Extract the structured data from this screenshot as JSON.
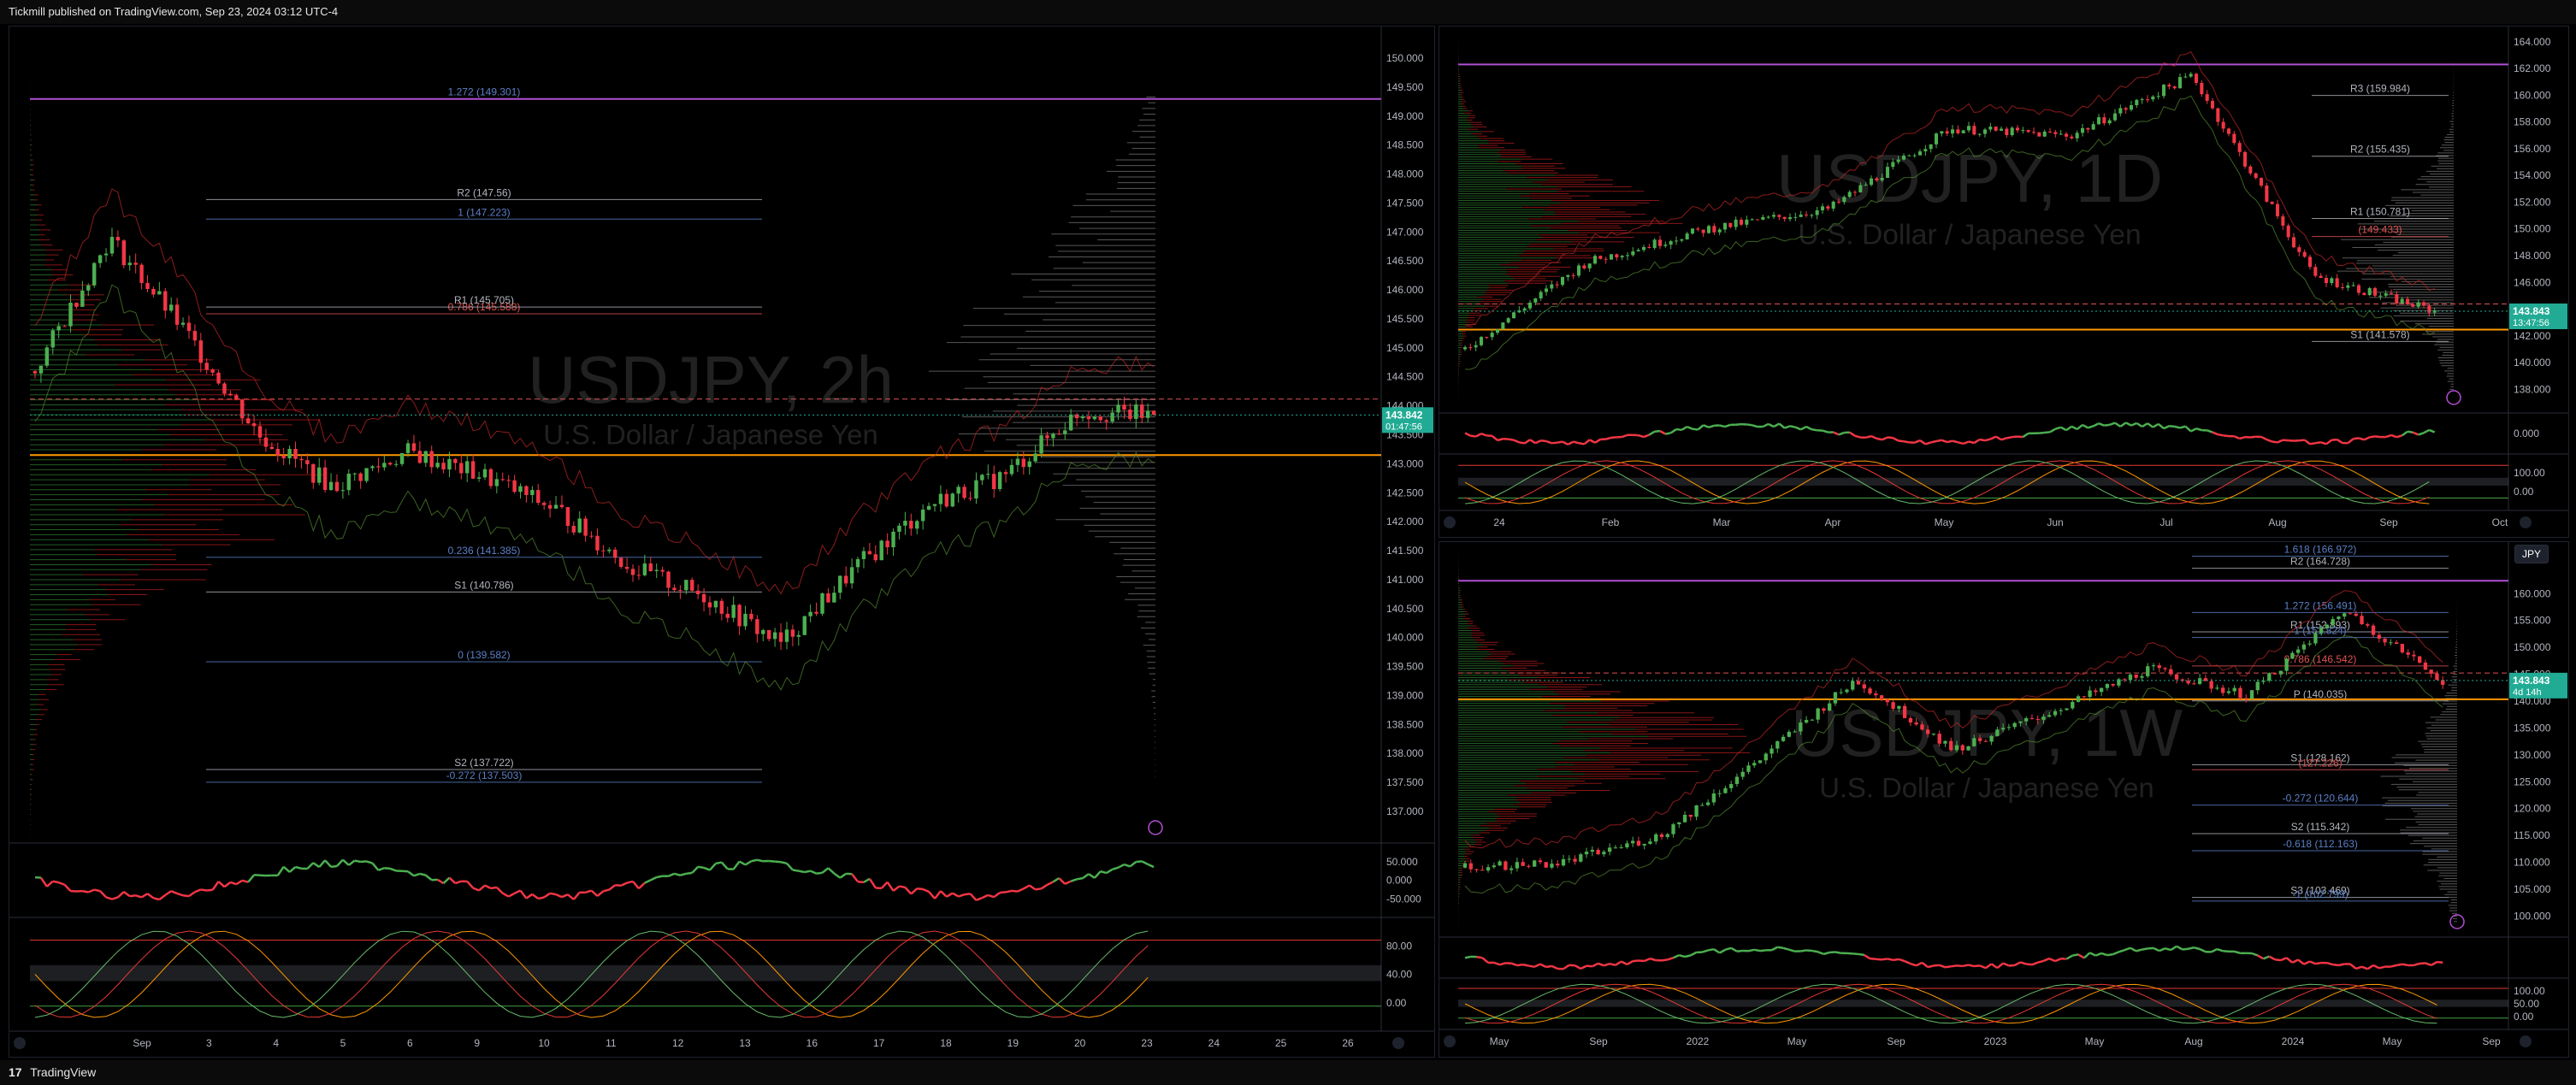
{
  "header": {
    "publisher": "Tickmill published on TradingView.com, Sep 23, 2024 03:12 UTC-4"
  },
  "footer": {
    "logo": "17",
    "brand": "TradingView"
  },
  "colors": {
    "up": "#4caf50",
    "down": "#f23645",
    "fib": "#5b7fc7",
    "orange": "#ff9800",
    "purple": "#b14fd3",
    "bg": "#000000"
  },
  "panes": [
    {
      "id": "left",
      "watermark": "USDJPY, 2h",
      "subtitle": "U.S. Dollar / Japanese Yen",
      "price_labels": [
        "150.000",
        "149.500",
        "149.000",
        "148.500",
        "148.000",
        "147.500",
        "147.000",
        "146.500",
        "146.000",
        "145.500",
        "145.000",
        "144.500",
        "144.000",
        "143.500",
        "143.000",
        "142.500",
        "142.000",
        "141.500",
        "141.000",
        "140.500",
        "140.000",
        "139.500",
        "139.000",
        "138.500",
        "138.000",
        "137.500",
        "137.000"
      ],
      "price_range": [
        136.6,
        150.4
      ],
      "last_price": {
        "price": "143.842",
        "countdown": "01:47:56",
        "value": 143.842
      },
      "time_labels": [
        "Sep",
        "3",
        "4",
        "5",
        "6",
        "9",
        "10",
        "11",
        "12",
        "13",
        "16",
        "17",
        "18",
        "19",
        "20",
        "23",
        "24",
        "25",
        "26"
      ],
      "levels": [
        {
          "label": "1.272 (149.301)",
          "value": 149.301,
          "kind": "fib"
        },
        {
          "label": "1 (147.223)",
          "value": 147.223,
          "kind": "fib"
        },
        {
          "label": "R2 (147.56)",
          "value": 147.56,
          "kind": "pivot"
        },
        {
          "label": "0.786 (145.588)",
          "value": 145.588,
          "kind": "fibred"
        },
        {
          "label": "R1 (145.705)",
          "value": 145.705,
          "kind": "pivot"
        },
        {
          "label": "0.236 (141.385)",
          "value": 141.385,
          "kind": "fib"
        },
        {
          "label": "S1 (140.786)",
          "value": 140.786,
          "kind": "pivot"
        },
        {
          "label": "0 (139.582)",
          "value": 139.582,
          "kind": "fib"
        },
        {
          "label": "S2 (137.722)",
          "value": 137.722,
          "kind": "pivot"
        },
        {
          "label": "-0.272 (137.503)",
          "value": 137.503,
          "kind": "fib"
        }
      ],
      "rsi_labels": [
        "50.000",
        "0.000",
        "-50.000"
      ],
      "stoch_labels": [
        "80.00",
        "40.00",
        "0.00"
      ]
    },
    {
      "id": "topright",
      "watermark": "USDJPY, 1D",
      "subtitle": "U.S. Dollar / Japanese Yen",
      "price_labels": [
        "164.000",
        "162.000",
        "160.000",
        "158.000",
        "156.000",
        "154.000",
        "152.000",
        "150.000",
        "148.000",
        "146.000",
        "144.000",
        "142.000",
        "140.000",
        "138.000"
      ],
      "price_range": [
        137,
        164.5
      ],
      "last_price": {
        "price": "143.843",
        "countdown": "13:47:56",
        "value": 143.843
      },
      "time_labels": [
        "24",
        "Feb",
        "Mar",
        "Apr",
        "May",
        "Jun",
        "Jul",
        "Aug",
        "Sep",
        "Oct"
      ],
      "levels": [
        {
          "label": "R3 (159.984)",
          "value": 159.984,
          "kind": "pivot"
        },
        {
          "label": "R2 (155.435)",
          "value": 155.435,
          "kind": "pivot"
        },
        {
          "label": "R1 (150.781)",
          "value": 150.781,
          "kind": "pivot"
        },
        {
          "label": "(149.433)",
          "value": 149.433,
          "kind": "red"
        },
        {
          "label": "S1 (141.578)",
          "value": 141.578,
          "kind": "pivot"
        }
      ],
      "rsi_labels": [
        "0.000"
      ],
      "stoch_labels": [
        "100.00",
        "0.00"
      ]
    },
    {
      "id": "bottomright",
      "watermark": "USDJPY, 1W",
      "subtitle": "U.S. Dollar / Japanese Yen",
      "symbol_badge": "JPY",
      "price_labels": [
        "160.000",
        "155.000",
        "150.000",
        "145.000",
        "140.000",
        "135.000",
        "130.000",
        "125.000",
        "120.000",
        "115.000",
        "110.000",
        "105.000",
        "100.000"
      ],
      "price_range": [
        98,
        168
      ],
      "last_price": {
        "price": "143.843",
        "countdown": "4d 14h",
        "value": 143.843
      },
      "time_labels": [
        "May",
        "Sep",
        "2022",
        "May",
        "Sep",
        "2023",
        "May",
        "Aug",
        "2024",
        "May",
        "Sep"
      ],
      "levels": [
        {
          "label": "1.618 (166.972)",
          "value": 166.972,
          "kind": "fib"
        },
        {
          "label": "R2 (164.728)",
          "value": 164.728,
          "kind": "pivot"
        },
        {
          "label": "1.272 (156.491)",
          "value": 156.491,
          "kind": "fib"
        },
        {
          "label": "R1 (152.893)",
          "value": 152.893,
          "kind": "pivot"
        },
        {
          "label": "1 (151.824)",
          "value": 151.824,
          "kind": "fib"
        },
        {
          "label": "0.786 (146.542)",
          "value": 146.542,
          "kind": "fibred"
        },
        {
          "label": "P (140.035)",
          "value": 140.035,
          "kind": "pivot"
        },
        {
          "label": "S1 (128.162)",
          "value": 128.162,
          "kind": "pivot"
        },
        {
          "label": "(127.226)",
          "value": 127.226,
          "kind": "red"
        },
        {
          "label": "-0.272 (120.644)",
          "value": 120.644,
          "kind": "fib"
        },
        {
          "label": "S2 (115.342)",
          "value": 115.342,
          "kind": "pivot"
        },
        {
          "label": "-0.618 (112.163)",
          "value": 112.163,
          "kind": "fib"
        },
        {
          "label": "S3 (103.469)",
          "value": 103.469,
          "kind": "pivot"
        },
        {
          "label": "-1 (102.799)",
          "value": 102.799,
          "kind": "fib"
        }
      ],
      "rsi_labels": [],
      "stoch_labels": [
        "100.00",
        "50.00",
        "0.00"
      ]
    }
  ],
  "chart_data": [
    {
      "type": "line",
      "title": "USDJPY, 2h",
      "x": [
        "Sep",
        "3",
        "4",
        "5",
        "6",
        "9",
        "10",
        "11",
        "12",
        "13",
        "16",
        "17",
        "18",
        "19",
        "20",
        "23"
      ],
      "series": [
        {
          "name": "USDJPY",
          "values": [
            144.6,
            146.9,
            145.3,
            143.5,
            142.6,
            143.2,
            142.8,
            142.2,
            141.2,
            140.7,
            139.9,
            141.2,
            142.3,
            142.8,
            143.9,
            143.84
          ]
        }
      ],
      "ylim": [
        136.6,
        150.4
      ]
    },
    {
      "type": "line",
      "title": "USDJPY, 1D",
      "x": [
        "24",
        "Feb",
        "Mar",
        "Apr",
        "May",
        "Jun",
        "Jul",
        "Aug",
        "Sep"
      ],
      "series": [
        {
          "name": "USDJPY",
          "values": [
            141.0,
            147.5,
            150.0,
            151.5,
            157.5,
            157.0,
            161.5,
            146.5,
            143.84
          ]
        }
      ],
      "ylim": [
        137,
        164.5
      ]
    },
    {
      "type": "line",
      "title": "USDJPY, 1W",
      "x": [
        "May",
        "Sep",
        "2022",
        "May",
        "Sep",
        "2023",
        "May",
        "Aug",
        "2024",
        "May",
        "Sep"
      ],
      "series": [
        {
          "name": "USDJPY",
          "values": [
            109,
            110,
            115,
            129,
            144,
            131,
            138,
            146,
            141,
            157,
            143.84
          ]
        }
      ],
      "ylim": [
        98,
        168
      ]
    }
  ]
}
